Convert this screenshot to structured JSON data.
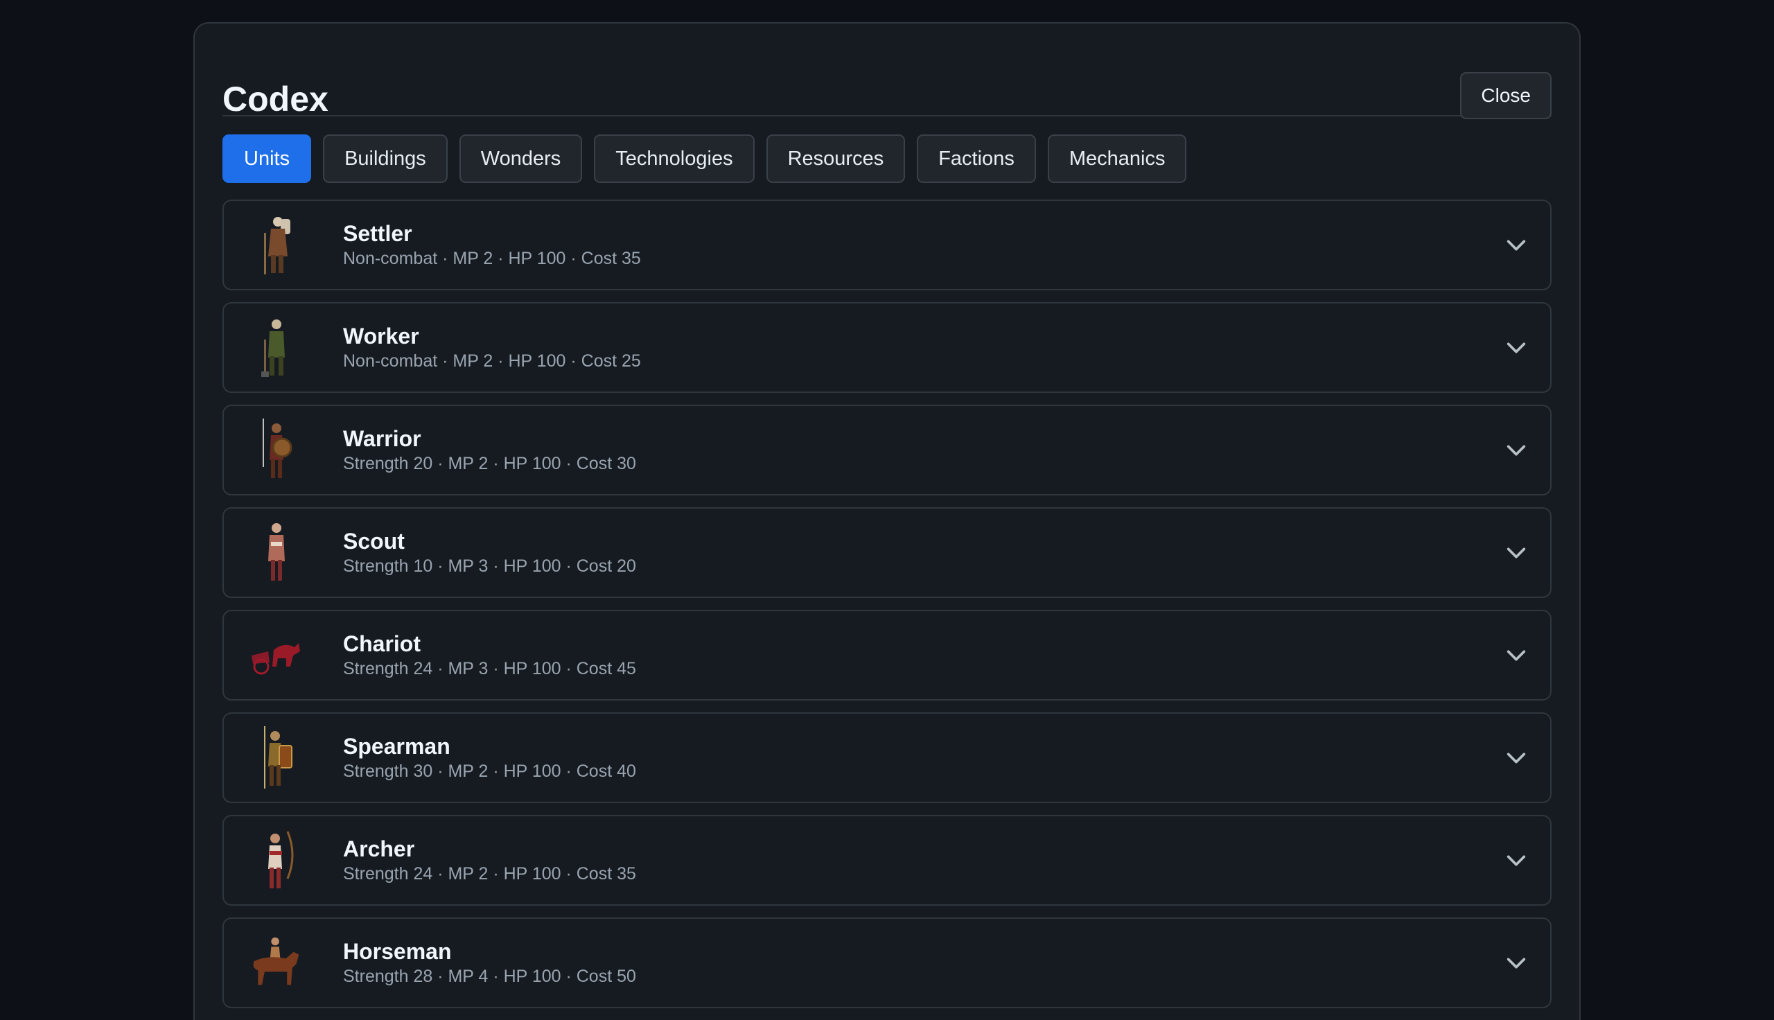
{
  "modal": {
    "title": "Codex",
    "close_label": "Close"
  },
  "tabs": [
    {
      "label": "Units",
      "active": true
    },
    {
      "label": "Buildings",
      "active": false
    },
    {
      "label": "Wonders",
      "active": false
    },
    {
      "label": "Technologies",
      "active": false
    },
    {
      "label": "Resources",
      "active": false
    },
    {
      "label": "Factions",
      "active": false
    },
    {
      "label": "Mechanics",
      "active": false
    }
  ],
  "units": [
    {
      "name": "Settler",
      "stats": "Non-combat · MP 2 · HP 100 · Cost 35",
      "icon": "settler-icon"
    },
    {
      "name": "Worker",
      "stats": "Non-combat · MP 2 · HP 100 · Cost 25",
      "icon": "worker-icon"
    },
    {
      "name": "Warrior",
      "stats": "Strength 20 · MP 2 · HP 100 · Cost 30",
      "icon": "warrior-icon"
    },
    {
      "name": "Scout",
      "stats": "Strength 10 · MP 3 · HP 100 · Cost 20",
      "icon": "scout-icon"
    },
    {
      "name": "Chariot",
      "stats": "Strength 24 · MP 3 · HP 100 · Cost 45",
      "icon": "chariot-icon"
    },
    {
      "name": "Spearman",
      "stats": "Strength 30 · MP 2 · HP 100 · Cost 40",
      "icon": "spearman-icon"
    },
    {
      "name": "Archer",
      "stats": "Strength 24 · MP 2 · HP 100 · Cost 35",
      "icon": "archer-icon"
    },
    {
      "name": "Horseman",
      "stats": "Strength 28 · MP 4 · HP 100 · Cost 50",
      "icon": "horseman-icon"
    }
  ],
  "colors": {
    "accent": "#1f6feb",
    "background": "#0d1117",
    "panel": "#161b22",
    "border": "#30363d"
  }
}
